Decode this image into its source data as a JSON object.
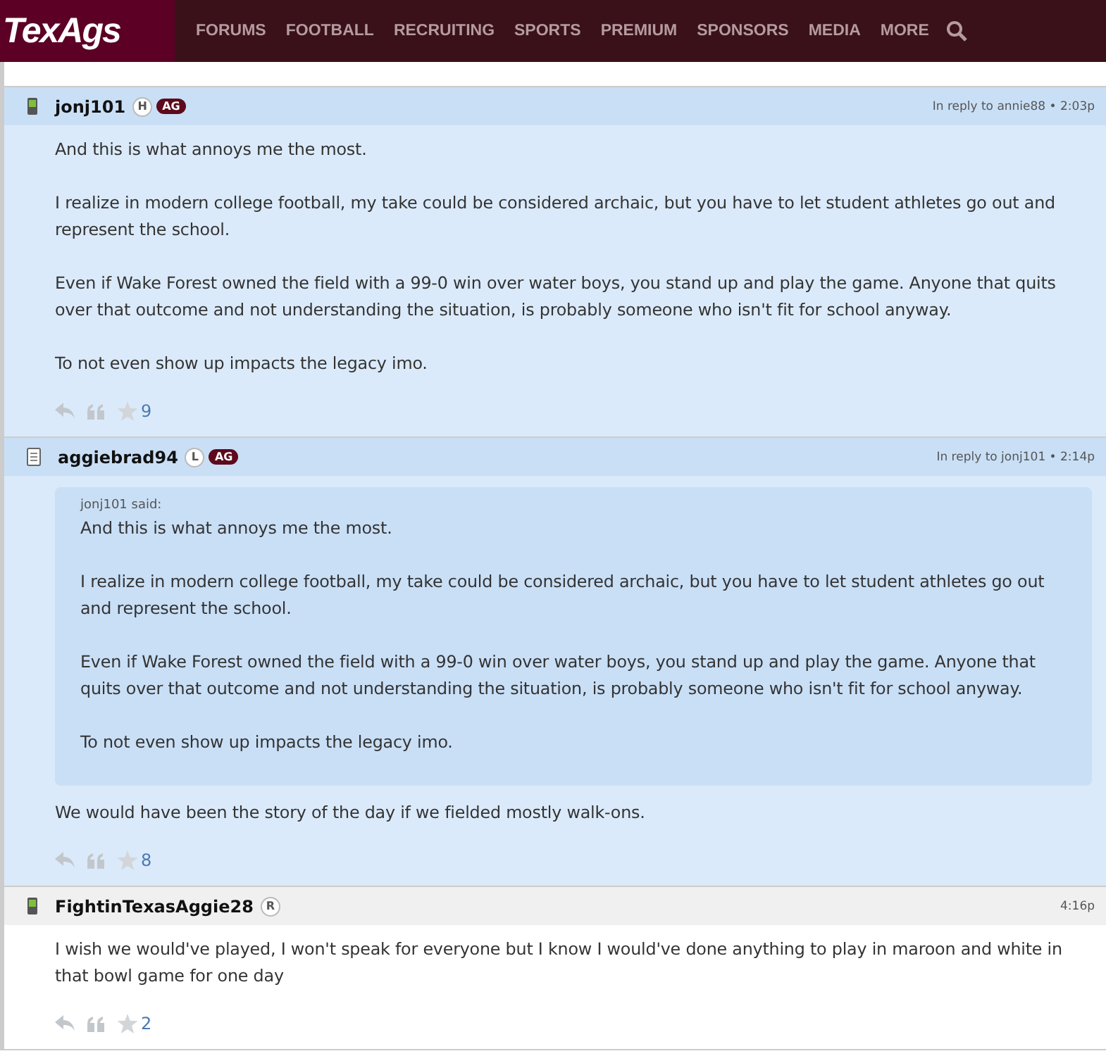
{
  "logo": "TexAgs",
  "nav": [
    "FORUMS",
    "FOOTBALL",
    "RECRUITING",
    "SPORTS",
    "PREMIUM",
    "SPONSORS",
    "MEDIA",
    "MORE"
  ],
  "posts": [
    {
      "highlighted": true,
      "kind": "phone",
      "user": "jonj101",
      "badges": [
        {
          "kind": "letter",
          "text": "H"
        },
        {
          "kind": "ag",
          "text": "AG"
        }
      ],
      "meta": "In reply to annie88 • 2:03p",
      "paragraphs": [
        "And this is what annoys me the most.",
        "I realize in modern college football, my take could be considered archaic, but you have to let student athletes go out and represent the school.",
        "Even if Wake Forest owned the field with a 99-0 win over water boys, you stand up and play the game. Anyone that quits over that outcome and not understanding the situation, is probably someone who isn't fit for school anyway.",
        "To not even show up impacts the legacy imo."
      ],
      "stars": "9"
    },
    {
      "highlighted": true,
      "kind": "tablet",
      "user": "aggiebrad94",
      "badges": [
        {
          "kind": "letter",
          "text": "L"
        },
        {
          "kind": "ag",
          "text": "AG"
        }
      ],
      "meta": "In reply to jonj101 • 2:14p",
      "quote": {
        "author": "jonj101 said:",
        "paragraphs": [
          "And this is what annoys me the most.",
          "I realize in modern college football, my take could be considered archaic, but you have to let student athletes go out and represent the school.",
          "Even if Wake Forest owned the field with a 99-0 win over water boys, you stand up and play the game. Anyone that quits over that outcome and not understanding the situation, is probably someone who isn't fit for school anyway.",
          "To not even show up impacts the legacy imo."
        ]
      },
      "paragraphs": [
        "We would have been the story of the day if we fielded mostly walk-ons."
      ],
      "stars": "8"
    },
    {
      "highlighted": false,
      "kind": "phone",
      "user": "FightinTexasAggie28",
      "badges": [
        {
          "kind": "letter",
          "text": "R"
        }
      ],
      "meta": "4:16p",
      "paragraphs": [
        "I wish we would've played, I won't speak for everyone but I know I would've done anything to play in maroon and white in that bowl game for one day"
      ],
      "stars": "2"
    }
  ]
}
